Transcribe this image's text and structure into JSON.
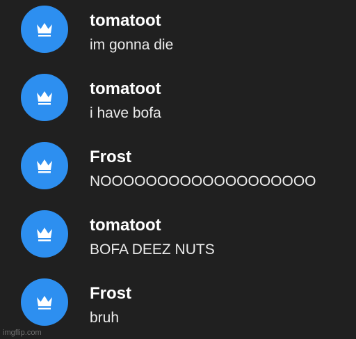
{
  "colors": {
    "background": "#202020",
    "avatar": "#2d8ff0",
    "name": "#ffffff",
    "text": "#ececec"
  },
  "messages": [
    {
      "author": "tomatoot",
      "text": "im gonna die",
      "avatar_icon": "crown-icon"
    },
    {
      "author": "tomatoot",
      "text": "i have bofa",
      "avatar_icon": "crown-icon"
    },
    {
      "author": "Frost",
      "text": "NOOOOOOOOOOOOOOOOOOO",
      "avatar_icon": "crown-icon"
    },
    {
      "author": "tomatoot",
      "text": "BOFA DEEZ NUTS",
      "avatar_icon": "crown-icon"
    },
    {
      "author": "Frost",
      "text": "bruh",
      "avatar_icon": "crown-icon"
    }
  ],
  "watermark": "imgflip.com"
}
